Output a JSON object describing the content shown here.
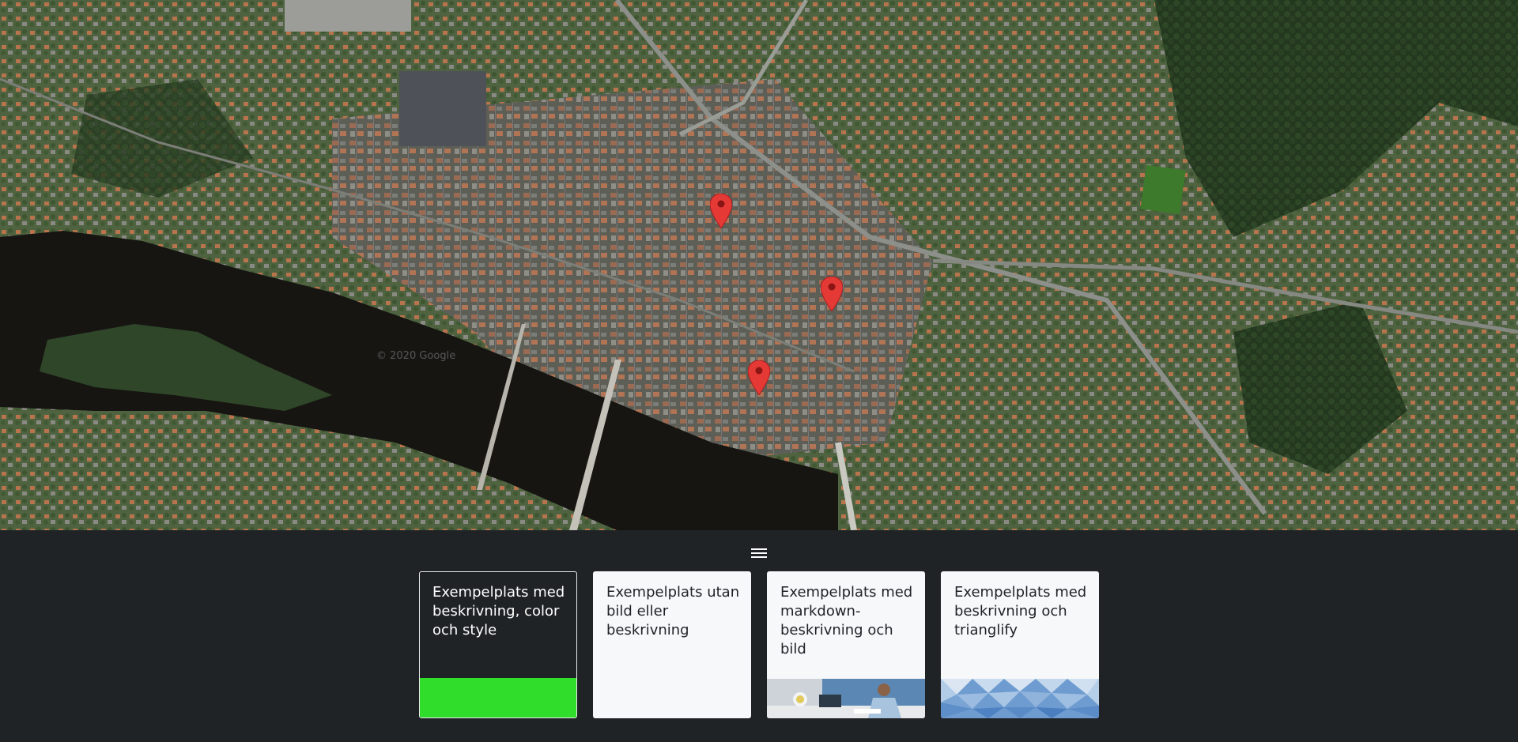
{
  "map": {
    "watermark": "© 2020 Google",
    "markers": [
      {
        "name": "marker-1",
        "color": "#e53935"
      },
      {
        "name": "marker-2",
        "color": "#e53935"
      },
      {
        "name": "marker-3",
        "color": "#e53935"
      }
    ]
  },
  "menu": {
    "icon": "hamburger-menu-icon"
  },
  "cards": [
    {
      "title": "Exempelplats med beskrivning, color och style",
      "image": "green-color-block",
      "accent": "#2fdd2a",
      "selected": true
    },
    {
      "title": "Exempelplats utan bild eller beskrivning",
      "image": "none",
      "selected": false
    },
    {
      "title": "Exempelplats med markdown-beskrivning och bild",
      "image": "photo-person-at-desk",
      "selected": false
    },
    {
      "title": "Exempelplats med beskrivning och trianglify",
      "image": "blue-triangle-pattern",
      "selected": false
    }
  ]
}
